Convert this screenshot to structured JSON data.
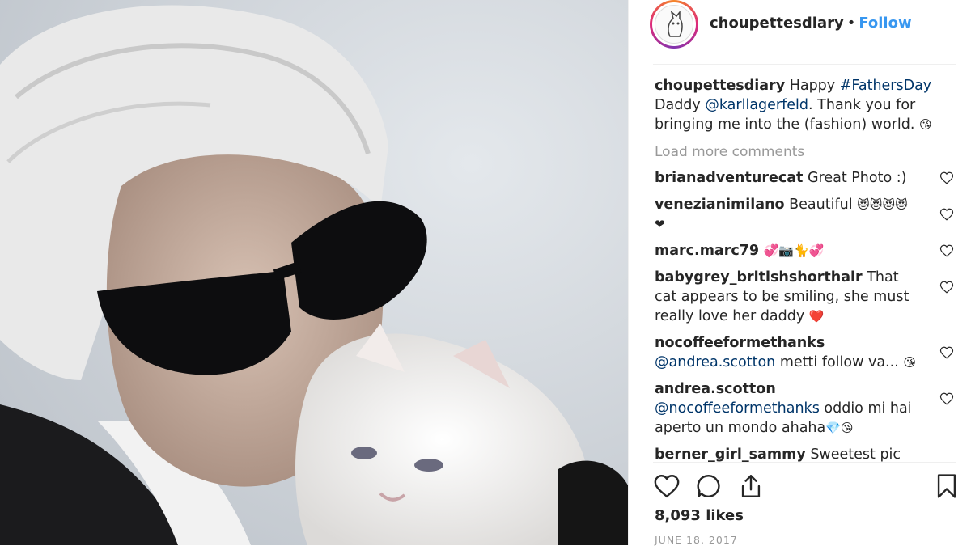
{
  "post": {
    "username": "choupettesdiary",
    "separator": "•",
    "follow_label": "Follow",
    "caption": {
      "user": "choupettesdiary",
      "text_1": "Happy",
      "hashtag": "#FathersDay",
      "text_2": "Daddy",
      "mention": "@karllagerfeld",
      "text_3": ". Thank you for bringing me into the (fashion) world.",
      "emoji": "😘"
    },
    "load_more_label": "Load more comments",
    "comments": [
      {
        "user": "brianadventurecat",
        "text": "Great Photo :)"
      },
      {
        "user": "venezianimilano",
        "text": "Beautiful",
        "emoji": "😻😻😻😻❤"
      },
      {
        "user": "marc.marc79",
        "text": "",
        "emoji": "💞📷🐈💞"
      },
      {
        "user": "babygrey_britishshorthair",
        "text": "That cat appears to be smiling, she must really love her daddy",
        "emoji": "❤️"
      },
      {
        "user": "nocoffeeformethanks",
        "mention": "@andrea.scotton",
        "text": "metti follow va...",
        "emoji": "😘"
      },
      {
        "user": "andrea.scotton",
        "mention": "@nocoffeeformethanks",
        "text": "oddio mi hai aperto un mondo ahaha",
        "emoji": "💎😘"
      },
      {
        "user": "berner_girl_sammy",
        "text": "Sweetest pic"
      }
    ],
    "likes": "8,093 likes",
    "date": "JUNE 18, 2017",
    "icons": [
      "heart-icon",
      "comment-icon",
      "share-icon",
      "bookmark-icon"
    ],
    "colors": {
      "link": "#003569",
      "follow": "#3897f0",
      "muted": "#999999"
    }
  }
}
